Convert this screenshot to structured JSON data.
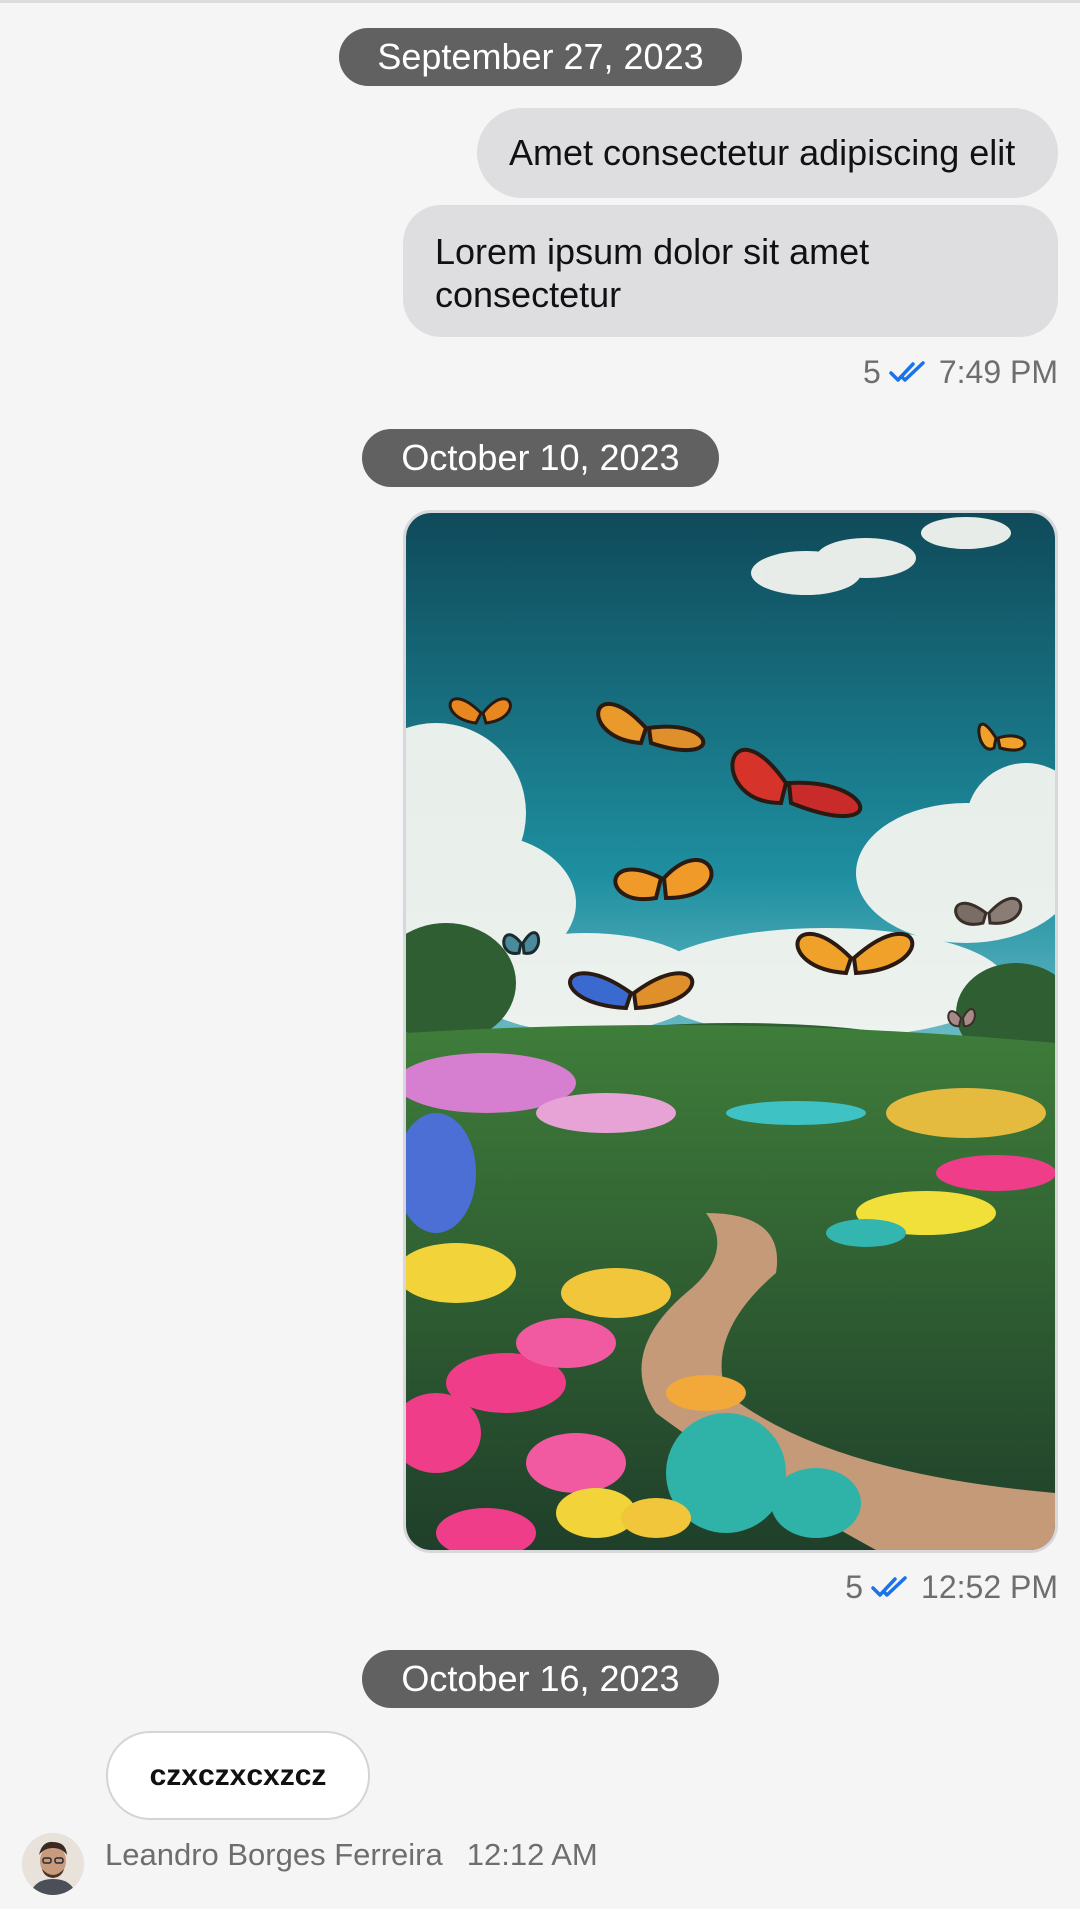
{
  "dates": {
    "first": "September 27, 2023",
    "second": "October 10, 2023",
    "third": "October 16, 2023"
  },
  "messages": {
    "msg1": "Amet consectetur adipiscing elit",
    "msg2_line1": "Lorem ipsum dolor sit amet",
    "msg2_line2": "consectetur",
    "meta1": {
      "count": "5",
      "time": "7:49 PM"
    },
    "meta2": {
      "count": "5",
      "time": "12:52 PM"
    },
    "incoming_text": "czxczxcxzcz"
  },
  "sender": {
    "name": "Leandro Borges Ferreira",
    "time": "12:12 AM"
  },
  "icons": {
    "read_receipt": "double-check-icon",
    "photo": "butterfly-garden-photo",
    "avatar": "user-avatar"
  },
  "colors": {
    "background": "#f5f5f6",
    "date_chip": "#616161",
    "bubble": "#dedee1",
    "read_check": "#1a73e8",
    "meta_text": "#6e6e6e"
  }
}
